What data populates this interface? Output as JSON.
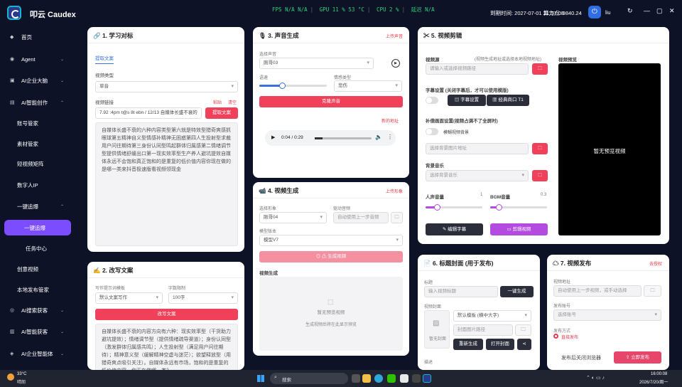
{
  "app": {
    "title": "叩云 Caudex"
  },
  "header": {
    "fps_label": "FPS",
    "fps1": "N/A",
    "fps2": "N/A",
    "gpu_label": "GPU",
    "gpu_val": "11 % 53 °C",
    "cpu_label": "CPU",
    "cpu_val": "2 %",
    "latency_label": "延迟",
    "latency_val": "N/A",
    "expire": "到期时间: 2027-07-01 21:57:08",
    "points": "算力点: 9840.24",
    "user": "liu"
  },
  "sidebar": {
    "items": [
      {
        "label": "首页",
        "icon": "◆"
      },
      {
        "label": "Agent",
        "icon": "◉"
      },
      {
        "label": "AI企业大脑",
        "icon": "▣"
      },
      {
        "label": "AI智能创作",
        "icon": "▤"
      },
      {
        "label": "账号管家"
      },
      {
        "label": "素材管家"
      },
      {
        "label": "短视频矩阵"
      },
      {
        "label": "数字人IP"
      },
      {
        "label": "一键追爆"
      },
      {
        "label": "一键追爆"
      },
      {
        "label": "任务中心"
      },
      {
        "label": "创意视频"
      },
      {
        "label": "本地发布管家"
      },
      {
        "label": "AI搜索获客",
        "icon": "◎"
      },
      {
        "label": "AI智能获客",
        "icon": "▥"
      },
      {
        "label": "AI企业智能体",
        "icon": "◈"
      }
    ]
  },
  "card1": {
    "title": "🔗 1. 学习对标",
    "tab": "提取文案",
    "video_type_label": "视频类型",
    "video_type_value": "草音",
    "link_label": "视频链接",
    "paste": "粘贴",
    "clear": "清空",
    "link_value": "7.92 :4pm t@s 8t ebn / 12/13 自媒体长盛不衰的",
    "extract_btn": "提取文案",
    "text": "自媒体长盛不衰的六种内容类型第六就是特效型猎奇爽感抓眼球第五精神自义型情感补精神无困惑第四人生投射型求裁用户问往期待第三身份认同型鸣起群体归属感第二情绪调节型提供情绪舒缓出口第一现实效率型生产养人避坑提效自媒体永远不会饱和真正饱和的是重复的低价值内容你现在做的是哪一类来抖音极速版看视频领现金"
  },
  "card2": {
    "title": "✍ 2. 改写文案",
    "template_label": "写作提示词模板",
    "template_value": "默认文案写作",
    "limit_label": "字数限制",
    "limit_value": "100字",
    "rewrite_btn": "改写文案",
    "text": "自媒体长盛不衰的内容方向有六种：现实效率型（干货助力避坑提效）；情绪调节型（提供情绪疏导渠道）；身份认同型（激发群体归属感共鸣）；人生投射型（满足用户问往期待）；精神意义型（缓解精神空虚与迷茫）；欲望释放型（用猎奇爽点吸引关注）。自媒体永远有市场，饱和的是重复的低价值内容，你正在做哪一类？"
  },
  "card3": {
    "title": "🎙 3. 声音生成",
    "upload": "上传声音",
    "voice_label": "选择声音",
    "voice_value": "刚哥03",
    "speed_label": "语速",
    "emotion_label": "情感类型",
    "emotion_value": "悲伤",
    "gen_btn": "克隆声音",
    "download": "新的地址",
    "audio_time": "0:04 / 0:29"
  },
  "card4": {
    "title": "📹 4. 视频生成",
    "upload": "上传形象",
    "avatar_label": "选择形象",
    "avatar_value": "刚哥04",
    "driver_label": "驱动音频",
    "driver_placeholder": "自动使用上一步音频",
    "model_label": "模型版本",
    "model_value": "模型V7",
    "gen_btn": "⊙ ⚠ 生成视频",
    "result_label": "视频生成",
    "empty_title": "暂无预览视频",
    "empty_sub": "生成视频后将在此显示预览"
  },
  "card5": {
    "title": "✂ 5. 视频剪辑",
    "source_label": "视频源",
    "source_hint": "(视频生成地址或选择本地视频地址)",
    "source_placeholder": "请输入或选择视频路径",
    "subtitle_label": "字幕设置 (关闭字幕后，才可以使用模版)",
    "subtitle_btn": "字幕设置",
    "template_btn": "经典商口 T1",
    "fill_label": "补偿画面设置(视频占满不了全屏时)",
    "blur_label": "模糊视频背景",
    "fill_placeholder": "选择背景图片地址",
    "bgm_label": "背景音乐",
    "bgm_placeholder": "选择背景音乐",
    "voice_vol_label": "人声音量",
    "voice_vol_val": "1",
    "bgm_vol_label": "BGM音量",
    "bgm_vol_val": "0.3",
    "edit_sub_btn": "编辑字幕",
    "cut_btn": "剪辑视频",
    "preview_label": "视频预览",
    "preview_empty": "暂无预览视频"
  },
  "card6": {
    "title": "📄 6. 标题封面 (用于发布)",
    "title_label": "标题",
    "title_placeholder": "输入视频标题",
    "gen_btn": "一键生成",
    "cover_label": "视频封面",
    "cover_empty": "暂无封面",
    "template_value": "默认模板 (横中大字)",
    "cover_placeholder": "封面图片路径",
    "regen_btn": "重新生成",
    "open_btn": "打开封面",
    "desc_label": "描述"
  },
  "card7": {
    "title": "☁ 7. 视频发布",
    "auth": "去授权",
    "addr_label": "视频地址",
    "addr_placeholder": "自动使用上一步视频，或手动选择",
    "account_label": "发布账号",
    "account_placeholder": "选择账号",
    "mode_label": "发布方式",
    "mode_value": "直接发布",
    "close_label": "发布后关闭浏览器",
    "publish_btn": "⇪ 立即发布"
  },
  "taskbar": {
    "weather_temp": "33°C",
    "weather_desc": "晴朗",
    "search": "搜索",
    "time": "16:00:08",
    "date": "2026/7/20/周一"
  },
  "colors": {
    "accent": "#f0405a",
    "purple": "#7c4dff",
    "bg": "#0e1226"
  }
}
